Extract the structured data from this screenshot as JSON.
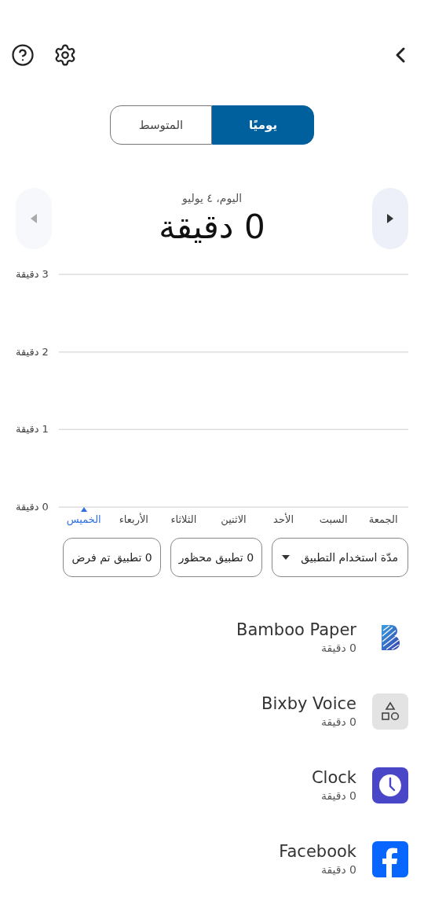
{
  "segments": [
    {
      "label": "يوميًا",
      "selected": true
    },
    {
      "label": "المتوسط",
      "selected": false
    }
  ],
  "date": "اليوم، ٤ يوليو",
  "total": "0 دقيقة",
  "prev_button": {
    "disabled": false
  },
  "next_button": {
    "disabled": true
  },
  "chart": {
    "days": [
      {
        "label": "الجمعة",
        "selected": false
      },
      {
        "label": "السبت",
        "selected": false
      },
      {
        "label": "الأحد",
        "selected": false
      },
      {
        "label": "الاثنين",
        "selected": false
      },
      {
        "label": "الثلاثاء",
        "selected": false
      },
      {
        "label": "الأربعاء",
        "selected": false
      },
      {
        "label": "الخميس",
        "selected": true
      }
    ],
    "chart_data": {
      "type": "bar",
      "values": [
        0,
        0,
        0,
        0,
        0,
        0,
        0
      ],
      "ylim": [
        0,
        3
      ],
      "yticks": [
        {
          "value": 3,
          "label": "3 دقيقة"
        },
        {
          "value": 2,
          "label": "2 دقيقة"
        },
        {
          "value": 1,
          "label": "1 دقيقة"
        },
        {
          "value": 0,
          "label": "0 دقيقة"
        }
      ]
    }
  },
  "filters": [
    {
      "kind": "dropdown",
      "label": "مدّة استخدام التطبيق"
    },
    {
      "kind": "chip",
      "label": "0 تطبيق محظور"
    },
    {
      "kind": "chip",
      "label": "0 تطبيق تم فرض"
    }
  ],
  "apps": [
    {
      "kind": "bamboo",
      "name": "Bamboo Paper",
      "usage": "0 دقيقة"
    },
    {
      "kind": "bixby",
      "name": "Bixby Voice",
      "usage": "0 دقيقة"
    },
    {
      "kind": "clock",
      "name": "Clock",
      "usage": "0 دقيقة"
    },
    {
      "kind": "facebook",
      "name": "Facebook",
      "usage": "0 دقيقة"
    }
  ]
}
